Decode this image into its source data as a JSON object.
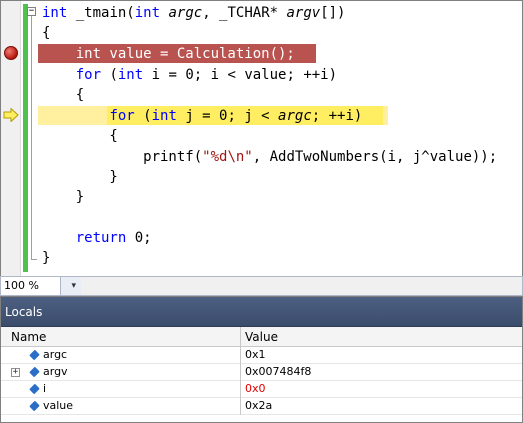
{
  "editor": {
    "lines": [
      {
        "parts": [
          {
            "t": "int",
            "c": "kw"
          },
          {
            "t": " _tmain("
          },
          {
            "t": "int",
            "c": "kw"
          },
          {
            "t": " "
          },
          {
            "t": "argc",
            "c": "it"
          },
          {
            "t": ", _TCHAR* "
          },
          {
            "t": "argv",
            "c": "it"
          },
          {
            "t": "[])"
          }
        ]
      },
      {
        "parts": [
          {
            "t": "{"
          }
        ]
      },
      {
        "parts": [
          {
            "t": "    int value = Calculation();",
            "c": "bp"
          }
        ]
      },
      {
        "parts": [
          {
            "t": "    "
          },
          {
            "t": "for",
            "c": "kw"
          },
          {
            "t": " ("
          },
          {
            "t": "int",
            "c": "kw"
          },
          {
            "t": " i = 0; i < value; ++i)"
          }
        ]
      },
      {
        "parts": [
          {
            "t": "    {"
          }
        ]
      },
      {
        "parts": [
          {
            "t": "        "
          },
          {
            "t": "for",
            "c": "kw"
          },
          {
            "t": " ("
          },
          {
            "t": "int",
            "c": "kw"
          },
          {
            "t": " j = 0; j < "
          },
          {
            "t": "argc",
            "c": "it"
          },
          {
            "t": "; ++i)"
          }
        ]
      },
      {
        "parts": [
          {
            "t": "        {"
          }
        ]
      },
      {
        "parts": [
          {
            "t": "            printf("
          },
          {
            "t": "\"%d\\n\"",
            "c": "str"
          },
          {
            "t": ", AddTwoNumbers(i, j^value));"
          }
        ]
      },
      {
        "parts": [
          {
            "t": "        }"
          }
        ]
      },
      {
        "parts": [
          {
            "t": "    }"
          }
        ]
      },
      {
        "parts": [
          {
            "t": ""
          }
        ]
      },
      {
        "parts": [
          {
            "t": "    "
          },
          {
            "t": "return",
            "c": "kw"
          },
          {
            "t": " 0;"
          }
        ]
      },
      {
        "parts": [
          {
            "t": "}"
          }
        ]
      }
    ],
    "colors": {
      "keyword": "#0000ff",
      "string": "#a31515",
      "breakpoint_bg": "#b85350",
      "current_statement_bg": "#ffee62",
      "change_bar": "#4ec24e"
    },
    "icons": {
      "breakpoint": "breakpoint-icon",
      "current_statement": "current-statement-arrow-icon"
    }
  },
  "zoom": {
    "level": "100 %",
    "arrow": "▾"
  },
  "locals": {
    "title": "Locals",
    "columns": {
      "name": "Name",
      "value": "Value"
    },
    "rows": [
      {
        "expander": "",
        "name": "argc",
        "value": "0x1",
        "changed": false
      },
      {
        "expander": "+",
        "name": "argv",
        "value": "0x007484f8",
        "changed": false
      },
      {
        "expander": "",
        "name": "i",
        "value": "0x0",
        "changed": true
      },
      {
        "expander": "",
        "name": "value",
        "value": "0x2a",
        "changed": false
      }
    ]
  }
}
